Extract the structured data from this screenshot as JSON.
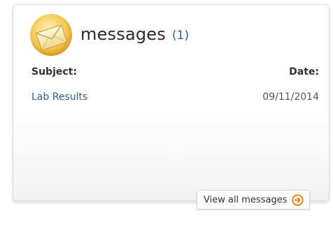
{
  "widget": {
    "title": "messages",
    "count": "(1)",
    "icon": "envelope-icon",
    "accent_color": "#2d5f9a",
    "arrow_color": "#f07a12"
  },
  "columns": {
    "subject": "Subject:",
    "date": "Date:"
  },
  "messages": [
    {
      "subject": "Lab Results",
      "date": "09/11/2014"
    }
  ],
  "footer": {
    "view_all_label": "View all messages",
    "arrow_icon": "arrow-right-circle-icon"
  }
}
